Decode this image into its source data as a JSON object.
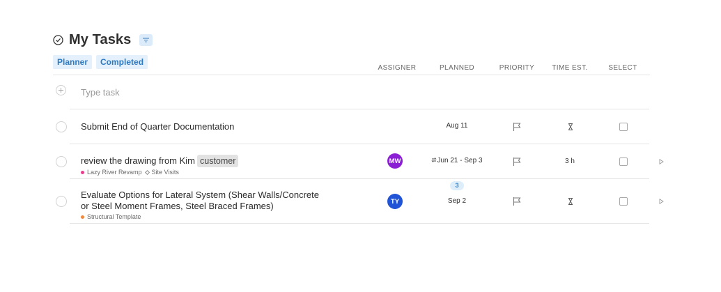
{
  "header": {
    "title": "My Tasks",
    "icon": "check-circle-icon",
    "filter_icon": "filter-icon"
  },
  "tabs": [
    {
      "label": "Planner"
    },
    {
      "label": "Completed"
    }
  ],
  "columns": {
    "assigner": "ASSIGNER",
    "planned": "PLANNED",
    "priority": "PRIORITY",
    "time_est": "TIME EST.",
    "select": "SELECT"
  },
  "new_task": {
    "placeholder": "Type task",
    "value": ""
  },
  "tasks": [
    {
      "title": "Submit End of Quarter Documentation",
      "planned": "Aug 11",
      "time_est": "",
      "time_icon": "hourglass-icon",
      "priority_icon": "flag-icon"
    },
    {
      "title": "review the drawing from Kim",
      "tag": "customer",
      "project": "Lazy River Revamp",
      "project_color": "#e83e8c",
      "section": "Site Visits",
      "assigner_initials": "MW",
      "assigner_color": "#8a1fd4",
      "planned": "Jun 21 - Sep 3",
      "planned_icon": "recurring-icon",
      "time_est": "3 h",
      "priority_icon": "flag-icon"
    },
    {
      "title_line1": "Evaluate Options for Lateral System (Shear Walls/Concrete",
      "title_line2": "or Steel Moment Frames, Steel Braced Frames)",
      "project": "Structural Template",
      "project_color": "#f0883e",
      "assigner_initials": "TY",
      "assigner_color": "#2153d6",
      "count": "3",
      "planned": "Sep 2",
      "time_est": "",
      "time_icon": "hourglass-icon",
      "priority_icon": "flag-icon"
    }
  ]
}
